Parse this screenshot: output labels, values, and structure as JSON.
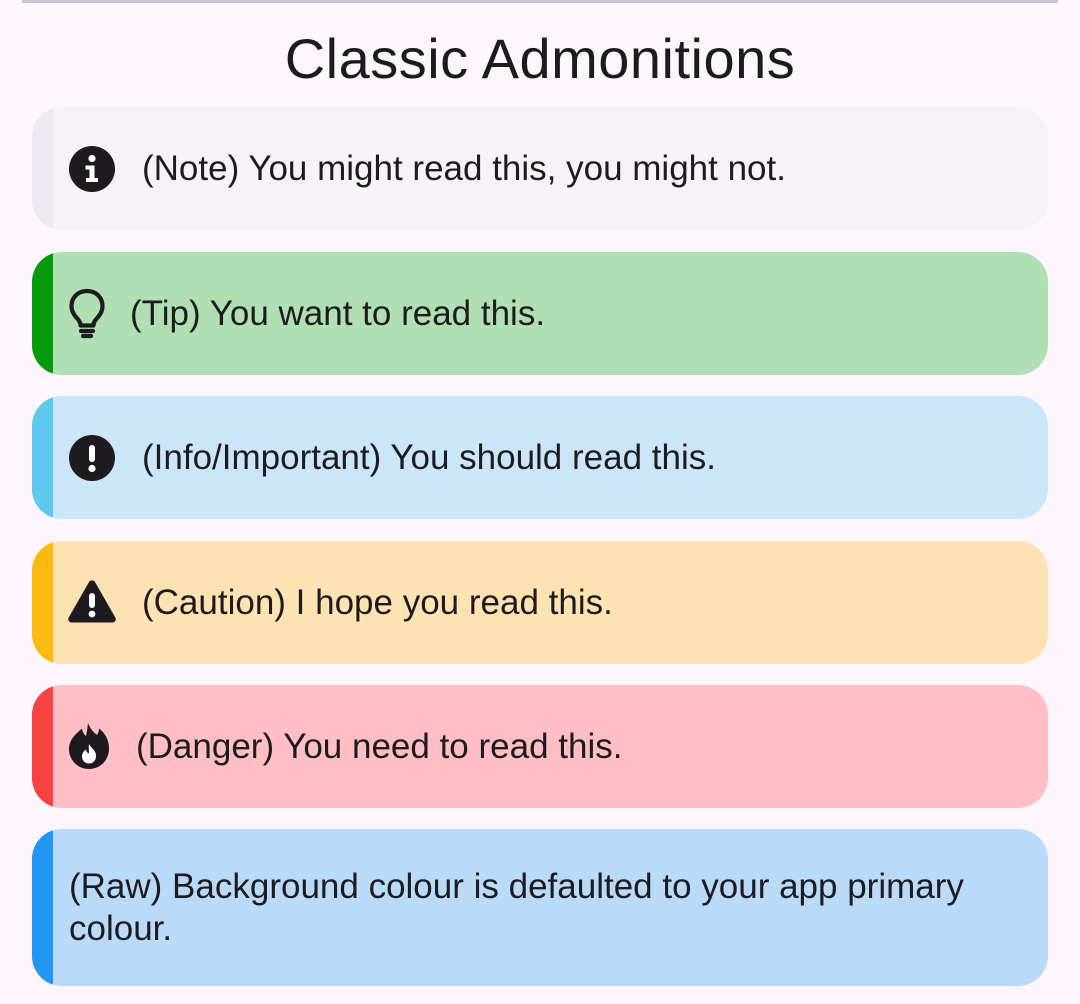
{
  "page": {
    "title": "Classic Admonitions"
  },
  "admonitions": [
    {
      "kind": "note",
      "icon": "info-circle-icon",
      "text": "(Note) You might read this, you might not.",
      "background": "#f6f2f8",
      "accent": "#eceaf0"
    },
    {
      "kind": "tip",
      "icon": "lightbulb-icon",
      "text": "(Tip) You want to read this.",
      "background": "#b0dfb4",
      "accent": "#079a0d"
    },
    {
      "kind": "info",
      "icon": "exclamation-circle-icon",
      "text": "(Info/Important) You should read this.",
      "background": "#cbe6f8",
      "accent": "#5ec8ef"
    },
    {
      "kind": "caution",
      "icon": "warning-triangle-icon",
      "text": "(Caution) I hope you read this.",
      "background": "#fee3b2",
      "accent": "#fcba10"
    },
    {
      "kind": "danger",
      "icon": "fire-icon",
      "text": "(Danger) You need to read this.",
      "background": "#ffbfc4",
      "accent": "#f84343"
    },
    {
      "kind": "raw",
      "icon": "",
      "text": "(Raw) Background colour is defaulted to your app primary colour.",
      "background": "#b9daf9",
      "accent": "#2196f3"
    }
  ]
}
